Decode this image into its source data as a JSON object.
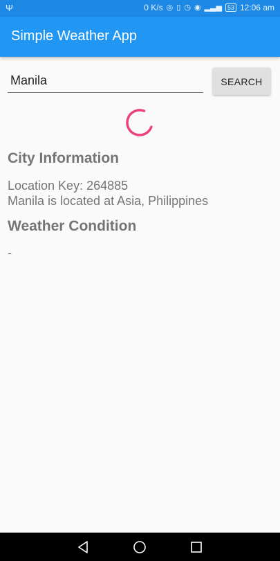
{
  "status_bar": {
    "speed": "0 K/s",
    "battery": "53",
    "time": "12:06 am",
    "icons": [
      "usb-icon",
      "hotspot-icon",
      "vibrate-icon",
      "alarm-icon",
      "eye-comfort-icon",
      "signal-icon",
      "battery-icon"
    ]
  },
  "app_bar": {
    "title": "Simple Weather App"
  },
  "search": {
    "value": "Manila",
    "button_label": "SEARCH"
  },
  "city_info": {
    "heading": "City Information",
    "location_key": "Location Key: 264885",
    "located_at": "Manila is located at Asia, Philippines"
  },
  "weather": {
    "heading": "Weather Condition",
    "value": "-"
  },
  "colors": {
    "status_bar": "#1e88e5",
    "app_bar": "#2196f3",
    "spinner": "#ec407a",
    "text": "#757575"
  }
}
